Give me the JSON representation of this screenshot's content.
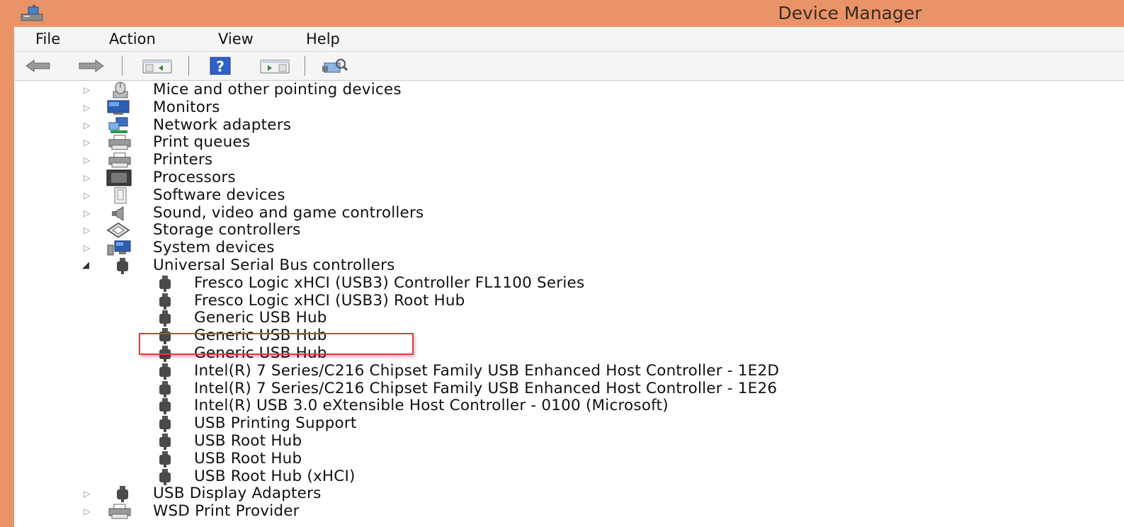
{
  "window": {
    "title": "Device Manager"
  },
  "menubar": {
    "items": [
      "File",
      "Action",
      "View",
      "Help"
    ]
  },
  "toolbar": {
    "buttons": [
      {
        "name": "back-icon"
      },
      {
        "name": "forward-icon"
      },
      {
        "name": "show-hide-console-tree-icon"
      },
      {
        "name": "help-icon"
      },
      {
        "name": "show-hide-action-pane-icon"
      },
      {
        "name": "scan-hardware-changes-icon"
      }
    ]
  },
  "tree": {
    "categories": [
      {
        "label": "Mice and other pointing devices",
        "icon": "mouse-icon",
        "expanded": false
      },
      {
        "label": "Monitors",
        "icon": "monitor-icon",
        "expanded": false
      },
      {
        "label": "Network adapters",
        "icon": "network-adapter-icon",
        "expanded": false
      },
      {
        "label": "Print queues",
        "icon": "printer-icon",
        "expanded": false
      },
      {
        "label": "Printers",
        "icon": "printer-icon",
        "expanded": false
      },
      {
        "label": "Processors",
        "icon": "processor-icon",
        "expanded": false
      },
      {
        "label": "Software devices",
        "icon": "software-device-icon",
        "expanded": false
      },
      {
        "label": "Sound, video and game controllers",
        "icon": "speaker-icon",
        "expanded": false
      },
      {
        "label": "Storage controllers",
        "icon": "storage-icon",
        "expanded": false
      },
      {
        "label": "System devices",
        "icon": "system-device-icon",
        "expanded": false
      },
      {
        "label": "Universal Serial Bus controllers",
        "icon": "usb-icon",
        "expanded": true
      },
      {
        "label": "USB Display Adapters",
        "icon": "usb-icon",
        "expanded": false
      },
      {
        "label": "WSD Print Provider",
        "icon": "printer-icon",
        "expanded": false
      }
    ],
    "usb_children": [
      "Fresco Logic xHCI (USB3) Controller FL1100 Series",
      "Fresco Logic xHCI (USB3) Root Hub",
      "Generic USB Hub",
      "Generic USB Hub",
      "Generic USB Hub",
      "Intel(R) 7 Series/C216 Chipset Family USB Enhanced Host Controller - 1E2D",
      "Intel(R) 7 Series/C216 Chipset Family USB Enhanced Host Controller - 1E26",
      "Intel(R) USB 3.0 eXtensible Host Controller - 0100 (Microsoft)",
      "USB Printing Support",
      "USB Root Hub",
      "USB Root Hub",
      "USB Root Hub (xHCI)"
    ],
    "highlighted_child_index": 2
  },
  "colors": {
    "titlebar": "#e99468",
    "highlight": "#e63b3b"
  }
}
